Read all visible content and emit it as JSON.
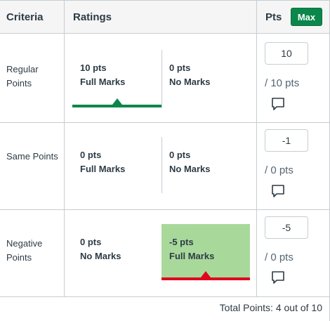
{
  "header": {
    "criteria_label": "Criteria",
    "ratings_label": "Ratings",
    "pts_label": "Pts",
    "max_button": "Max"
  },
  "criteria": [
    {
      "name": "Regular Points",
      "ratings": [
        {
          "points": "10 pts",
          "description": "Full Marks",
          "selected": true
        },
        {
          "points": "0 pts",
          "description": "No Marks",
          "selected": false
        }
      ],
      "score_value": "10",
      "out_of": "/ 10 pts"
    },
    {
      "name": "Same Points",
      "ratings": [
        {
          "points": "0 pts",
          "description": "Full Marks",
          "selected": false
        },
        {
          "points": "0 pts",
          "description": "No Marks",
          "selected": false
        }
      ],
      "score_value": "-1",
      "out_of": "/ 0 pts"
    },
    {
      "name": "Negative Points",
      "ratings": [
        {
          "points": "0 pts",
          "description": "No Marks",
          "selected": false
        },
        {
          "points": "-5 pts",
          "description": "Full Marks",
          "selected": true
        }
      ],
      "score_value": "-5",
      "out_of": "/ 0 pts"
    }
  ],
  "total": "Total Points: 4 out of 10",
  "colors": {
    "max_button": "#0b874b",
    "selected_green": "#0b874b",
    "selected_red": "#e0061f",
    "selected_fill": "#a8d99b"
  },
  "icons": {
    "comment": "comment-icon"
  }
}
